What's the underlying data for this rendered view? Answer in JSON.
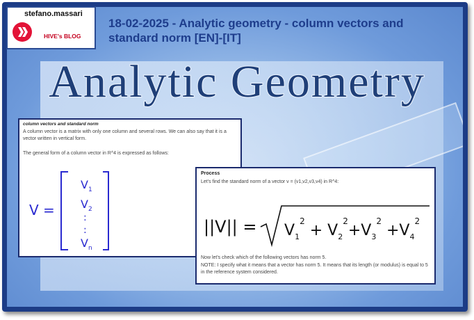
{
  "badge": {
    "author": "stefano.massari",
    "blog_name": "HIVE's BLOG",
    "logo_icon": "hive-logo-icon",
    "logo_color": "#e31337"
  },
  "post_title": "18-02-2025 - Analytic geometry - column vectors and standard norm [EN]-[IT]",
  "banner_title": "Analytic Geometry",
  "left_card": {
    "heading": "column vectors and standard norm",
    "paragraph1": "A column vector is a matrix with only one column and several rows. We can also say that it is a vector written in vertical form.",
    "paragraph2": "The general form of a column vector in R^4 is expressed as follows:",
    "formula_lhs": "V =",
    "entries": [
      "V1",
      "V2",
      ":",
      ":",
      "Vn"
    ]
  },
  "right_card": {
    "heading": "Process",
    "intro": "Let's find the standard norm of a vector v = (v1,v2,v3,v4) in R^4:",
    "formula": "||V|| = √(V1² + V2² + V3² + V4²)",
    "check": "Now let's check which of the following vectors has norm 5.",
    "note": "NOTE: I specify what it means that a vector has norm 5. It means that its length (or modulus) is equal to 5 in the reference system considered."
  },
  "colors": {
    "frame": "#1c3c86",
    "title_text": "#1e3d8c",
    "handwriting": "#2a2ad0",
    "banner_fill": "#1f3f78"
  }
}
